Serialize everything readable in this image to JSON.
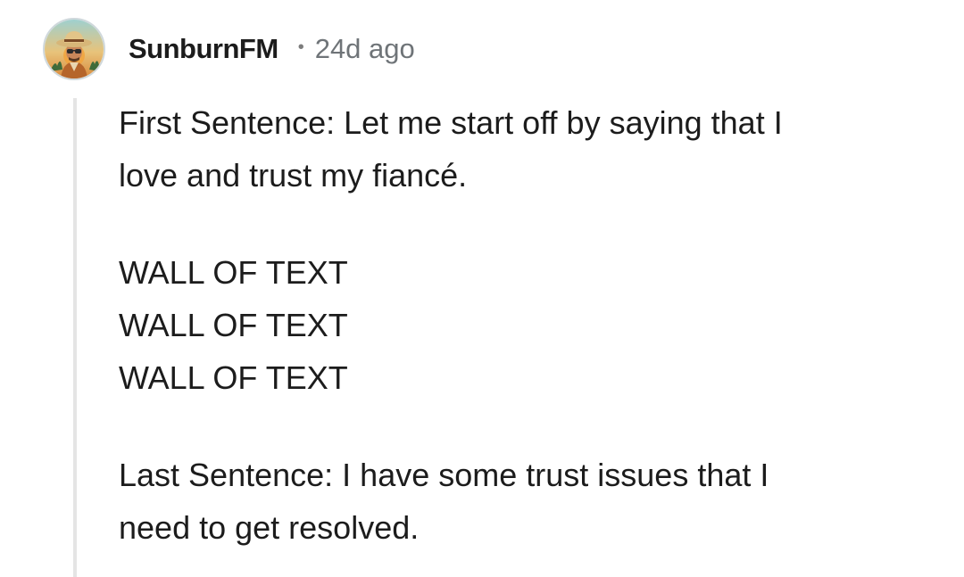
{
  "comment": {
    "author": "SunburnFM",
    "separator": "•",
    "timestamp": "24d ago",
    "avatar_icon": "cowboy-avatar-icon",
    "body": {
      "first_line_1": "First Sentence: Let me start off by saying that I",
      "first_line_2": "love and trust my fiancé.",
      "wall_lines": [
        "WALL OF TEXT",
        "WALL OF TEXT",
        "WALL OF TEXT"
      ],
      "last_line_1": "Last Sentence: I have some trust issues that I",
      "last_line_2": "need to get resolved."
    }
  },
  "colors": {
    "text": "#1c1c1c",
    "meta": "#6f7478",
    "thread_line": "#e5e5e5",
    "background": "#ffffff"
  }
}
